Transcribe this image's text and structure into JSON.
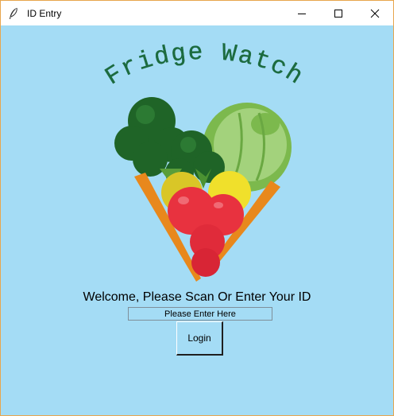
{
  "window": {
    "title": "ID Entry",
    "controls": [
      "minimize-icon",
      "maximize-icon",
      "close-icon"
    ],
    "background_color": "#a4dcf5"
  },
  "logo": {
    "title": "Fridge Watch",
    "title_color": "#1c6b3f",
    "image_icon": "vegetable-heart-icon"
  },
  "form": {
    "welcome_text": "Welcome, Please Scan Or Enter Your ID",
    "id_field": {
      "value": "",
      "placeholder": "Please Enter Here"
    },
    "login_label": "Login"
  }
}
